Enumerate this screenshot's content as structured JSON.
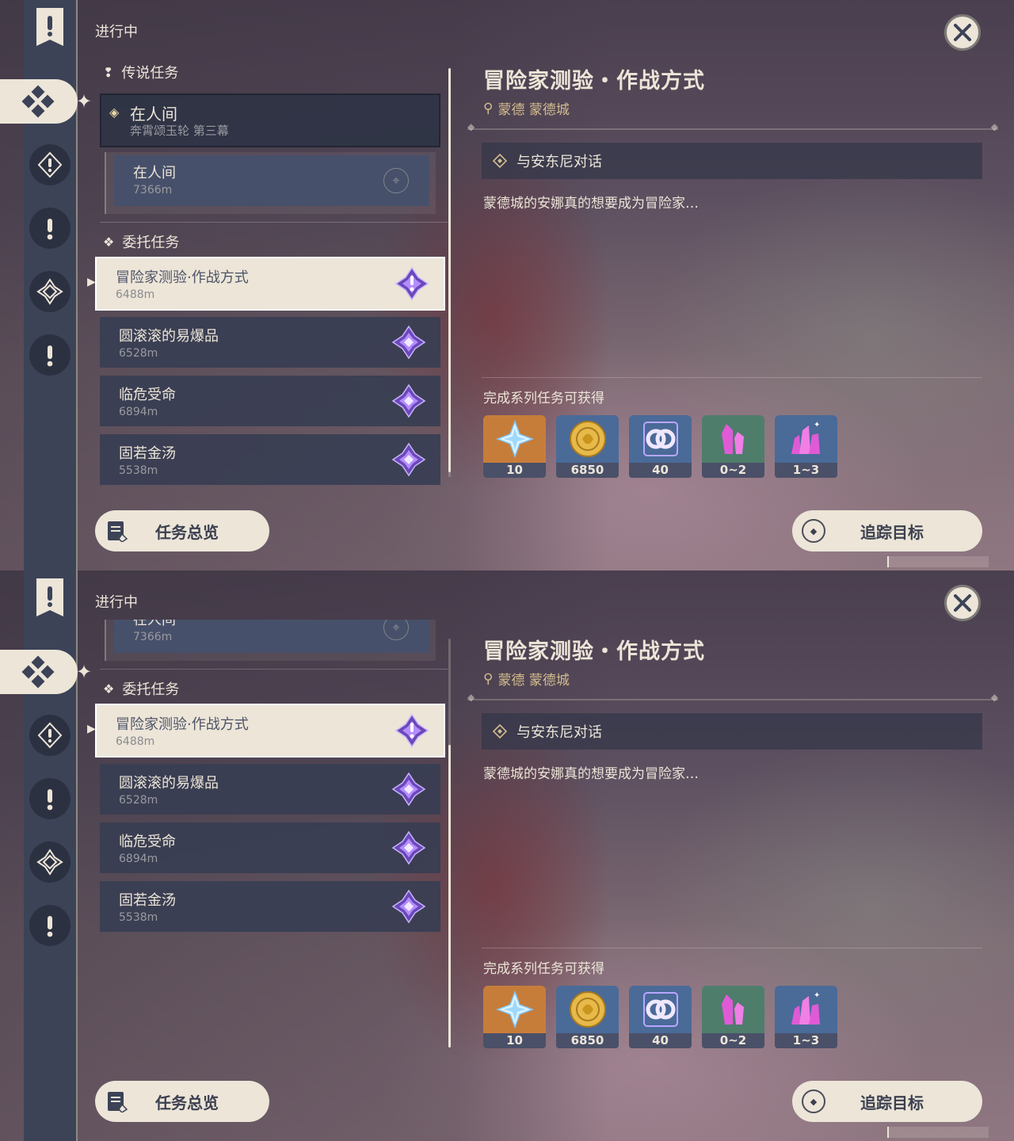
{
  "panels": [
    {
      "header": {
        "status": "进行中"
      },
      "sections": {
        "legend": {
          "title": "传说任务"
        },
        "commission": {
          "title": "委托任务"
        }
      },
      "legend_quest": {
        "title": "在人间",
        "subtitle": "奔霄颂玉轮 第三幕"
      },
      "sub_quest": {
        "title": "在人间",
        "distance": "7366m"
      },
      "quests": [
        {
          "title": "冒险家测验·作战方式",
          "distance": "6488m",
          "active": true
        },
        {
          "title": "圆滚滚的易爆品",
          "distance": "6528m",
          "active": false
        },
        {
          "title": "临危受命",
          "distance": "6894m",
          "active": false
        },
        {
          "title": "固若金汤",
          "distance": "5538m",
          "active": false
        }
      ],
      "detail": {
        "title": "冒险家测验・作战方式",
        "location": "蒙德 蒙德城",
        "objective": "与安东尼对话",
        "description": "蒙德城的安娜真的想要成为冒险家…",
        "rewards_label": "完成系列任务可获得",
        "rewards": [
          {
            "icon": "primogem-icon",
            "count": "10"
          },
          {
            "icon": "mora-icon",
            "count": "6850"
          },
          {
            "icon": "adventure-exp-icon",
            "count": "40"
          },
          {
            "icon": "crystal-shard-icon",
            "count": "0~2"
          },
          {
            "icon": "crystal-cluster-icon",
            "count": "1~3"
          }
        ]
      },
      "buttons": {
        "overview": "任务总览",
        "track": "追踪目标"
      },
      "scroll": {
        "position": 0.0
      }
    },
    {
      "header": {
        "status": "进行中"
      },
      "sections": {
        "commission": {
          "title": "委托任务"
        }
      },
      "sub_quest": {
        "title": "在人间",
        "distance": "7366m"
      },
      "quests": [
        {
          "title": "冒险家测验·作战方式",
          "distance": "6488m",
          "active": true
        },
        {
          "title": "圆滚滚的易爆品",
          "distance": "6528m",
          "active": false
        },
        {
          "title": "临危受命",
          "distance": "6894m",
          "active": false
        },
        {
          "title": "固若金汤",
          "distance": "5538m",
          "active": false
        }
      ],
      "detail": {
        "title": "冒险家测验・作战方式",
        "location": "蒙德 蒙德城",
        "objective": "与安东尼对话",
        "description": "蒙德城的安娜真的想要成为冒险家…",
        "rewards_label": "完成系列任务可获得",
        "rewards": [
          {
            "icon": "primogem-icon",
            "count": "10"
          },
          {
            "icon": "mora-icon",
            "count": "6850"
          },
          {
            "icon": "adventure-exp-icon",
            "count": "40"
          },
          {
            "icon": "crystal-shard-icon",
            "count": "0~2"
          },
          {
            "icon": "crystal-cluster-icon",
            "count": "1~3"
          }
        ]
      },
      "buttons": {
        "overview": "任务总览",
        "track": "追踪目标"
      },
      "scroll": {
        "position": 1.0
      }
    }
  ],
  "colors": {
    "accent": "#ece5d8",
    "gold": "#d3bc8e",
    "card": "#383e52",
    "commission_purple": "#8a5cd6"
  }
}
